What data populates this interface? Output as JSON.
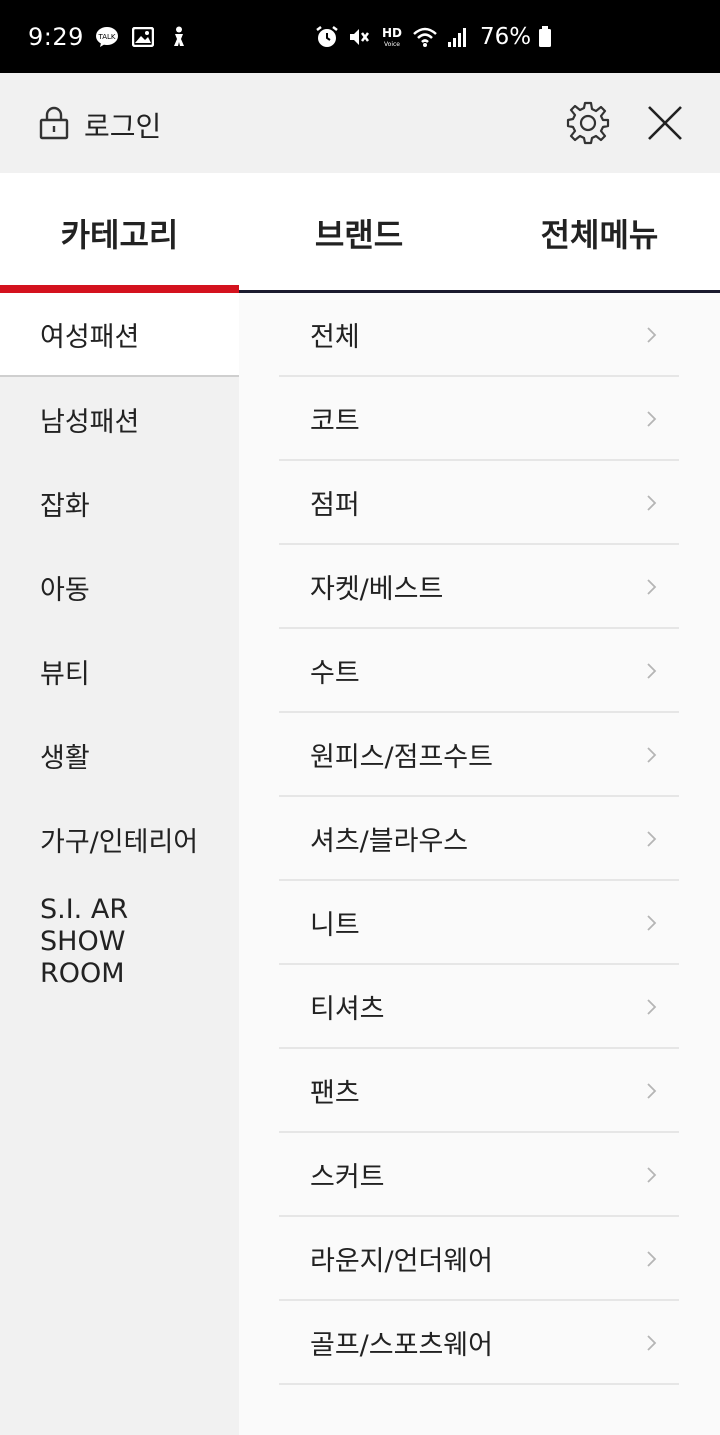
{
  "status_bar": {
    "time": "9:29",
    "left_icons": [
      "talk-icon",
      "gallery-icon",
      "accessibility-icon"
    ],
    "right_icons": [
      "alarm-icon",
      "mute-icon",
      "hd-voice-icon",
      "wifi-icon",
      "signal-icon",
      "battery-icon"
    ],
    "battery_text": "76%",
    "hd_label": "HD"
  },
  "header": {
    "login_label": "로그인",
    "lock_icon": "lock-icon",
    "settings_icon": "gear-icon",
    "close_icon": "close-icon"
  },
  "tabs": [
    {
      "label": "카테고리",
      "active": true
    },
    {
      "label": "브랜드",
      "active": false
    },
    {
      "label": "전체메뉴",
      "active": false
    }
  ],
  "categories": [
    {
      "label": "여성패션",
      "active": true
    },
    {
      "label": "남성패션",
      "active": false
    },
    {
      "label": "잡화",
      "active": false
    },
    {
      "label": "아동",
      "active": false
    },
    {
      "label": "뷰티",
      "active": false
    },
    {
      "label": "생활",
      "active": false
    },
    {
      "label": "가구/인테리어",
      "active": false
    },
    {
      "label": "S.I. AR SHOW ROOM",
      "active": false
    }
  ],
  "subcategories": [
    {
      "label": "전체"
    },
    {
      "label": "코트"
    },
    {
      "label": "점퍼"
    },
    {
      "label": "자켓/베스트"
    },
    {
      "label": "수트"
    },
    {
      "label": "원피스/점프수트"
    },
    {
      "label": "셔츠/블라우스"
    },
    {
      "label": "니트"
    },
    {
      "label": "티셔츠"
    },
    {
      "label": "팬츠"
    },
    {
      "label": "스커트"
    },
    {
      "label": "라운지/언더웨어"
    },
    {
      "label": "골프/스포츠웨어"
    }
  ],
  "colors": {
    "accent": "#d4121e",
    "header_bg": "#f1f1f1",
    "text": "#222222"
  }
}
